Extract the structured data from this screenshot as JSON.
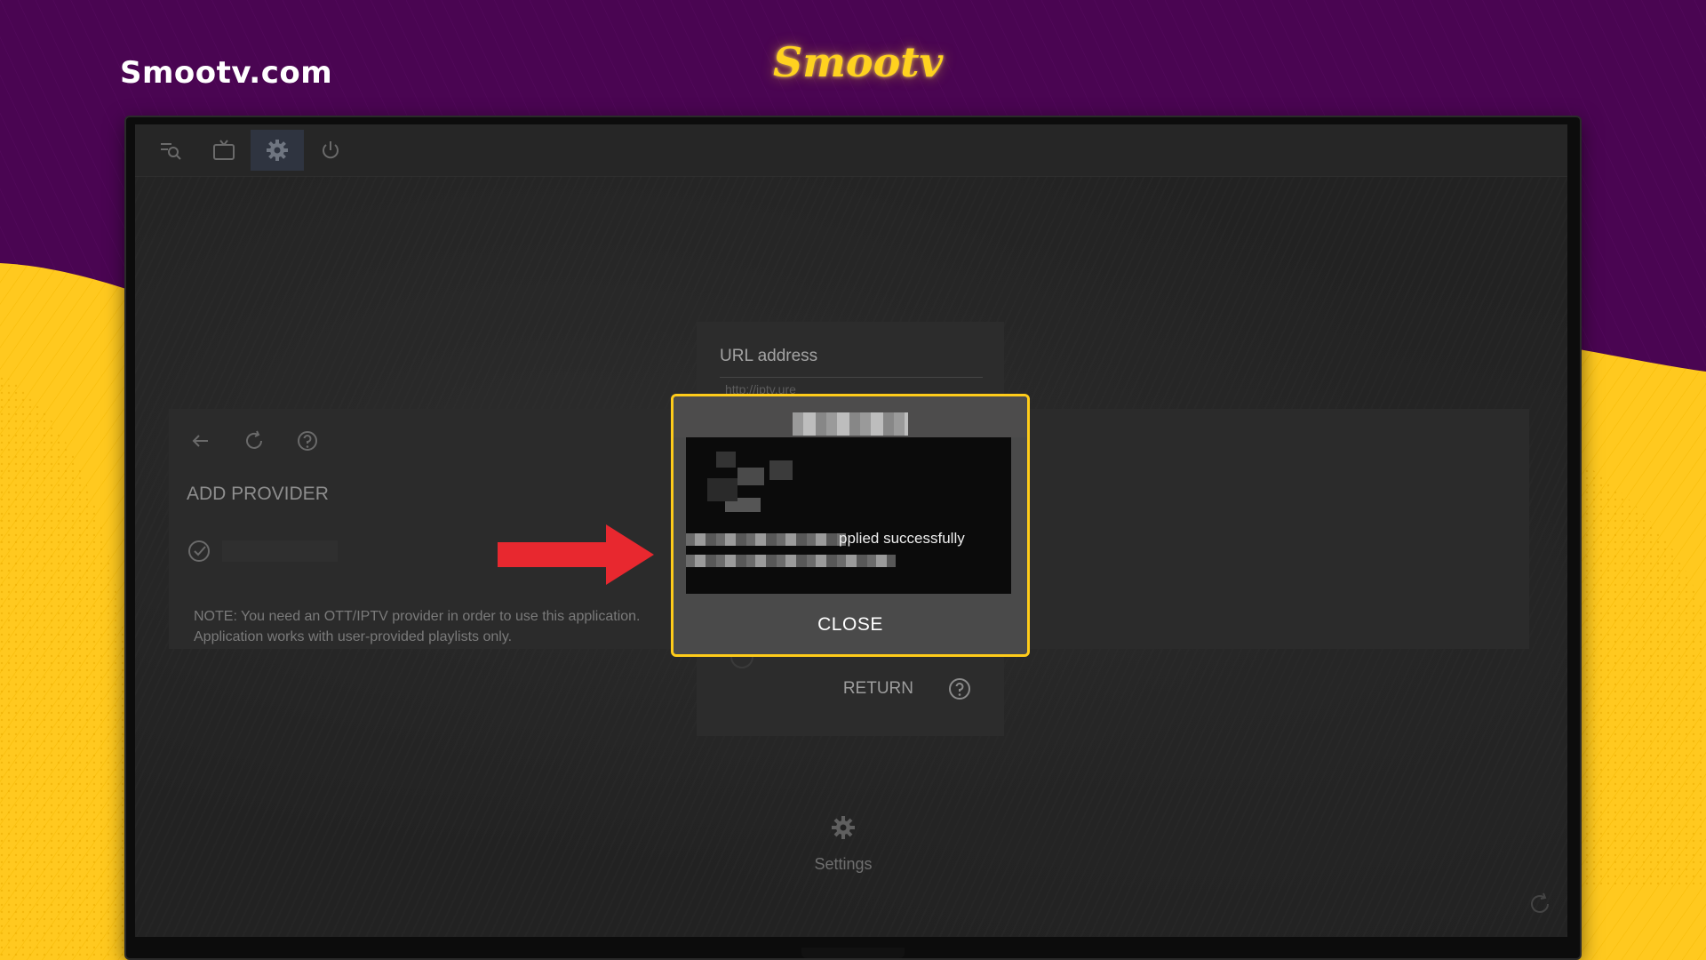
{
  "site": {
    "label": "Smootv.com",
    "logo_text": "Smootv"
  },
  "colors": {
    "purple_bg": "#4a0552",
    "yellow_bg": "#ffc91f",
    "dialog_border": "#ffcc1a",
    "arrow": "#e8282f"
  },
  "app": {
    "toolbar": [
      {
        "icon": "search-list-icon"
      },
      {
        "icon": "tv-icon"
      },
      {
        "icon": "gear-icon",
        "active": true
      },
      {
        "icon": "power-icon"
      }
    ],
    "provider_panel": {
      "toolbar_icons": [
        "back-arrow-icon",
        "refresh-icon",
        "help-icon"
      ],
      "title": "ADD PROVIDER",
      "note": "NOTE: You need an OTT/IPTV provider in order to use this application. Application works with user-provided playlists only."
    },
    "url_panel": {
      "label": "URL address",
      "value": "http://iptv.ure",
      "return_label": "RETURN"
    },
    "bottom": {
      "settings_label": "Settings"
    }
  },
  "dialog": {
    "message_visible": "pplied successfully",
    "close_label": "CLOSE"
  }
}
